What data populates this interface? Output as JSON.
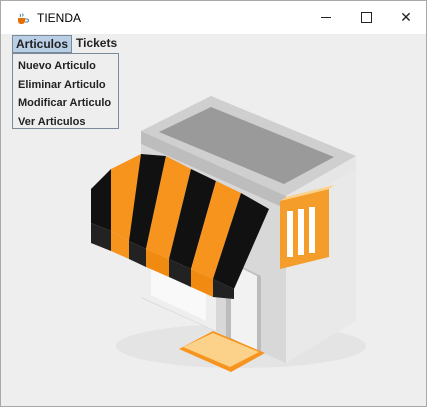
{
  "window": {
    "title": "TIENDA",
    "app_icon": "java-cup-icon",
    "controls": {
      "minimize": "minimize-icon",
      "maximize": "maximize-icon",
      "close_glyph": "✕"
    }
  },
  "menubar": {
    "menus": [
      {
        "label": "Articulos",
        "active": true
      },
      {
        "label": "Tickets",
        "active": false
      }
    ]
  },
  "dropdown": {
    "items": [
      {
        "label": "Nuevo Articulo"
      },
      {
        "label": "Eliminar Articulo"
      },
      {
        "label": "Modificar Articulo"
      },
      {
        "label": "Ver Articulos"
      }
    ]
  },
  "illustration": {
    "icon": "store-icon",
    "colors": {
      "orange": "#f7941d",
      "black": "#111111",
      "wall": "#dcdcdc",
      "sign": "#f59d2a"
    }
  }
}
